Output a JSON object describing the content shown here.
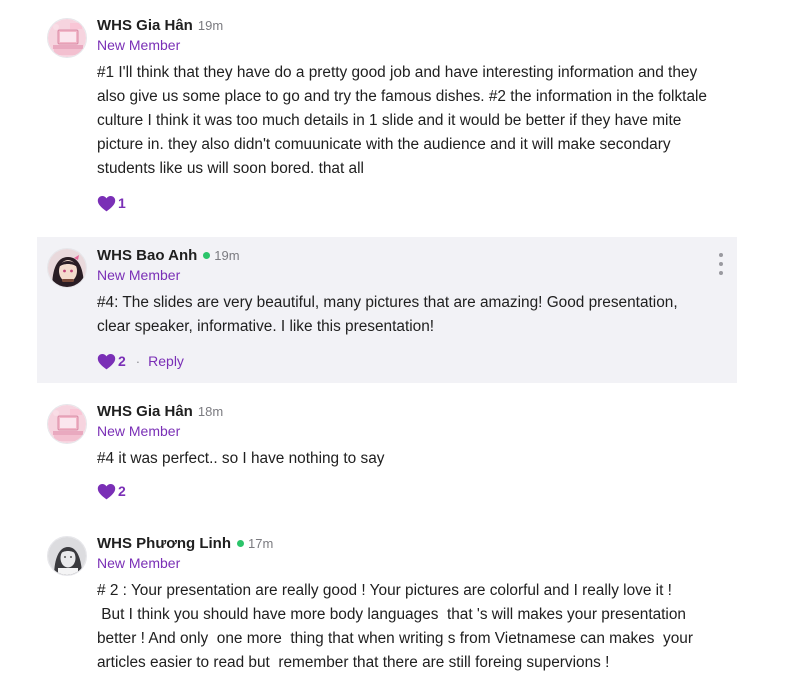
{
  "colors": {
    "accent": "#7a2fb6",
    "online": "#2bc46a",
    "highlight_bg": "#f2f2f6"
  },
  "comments": [
    {
      "author": "WHS Gia Hân",
      "time": "19m",
      "role": "New Member",
      "paragraphs": [
        "#1 I'll think that they have do a pretty good job and have interesting information and they also give us some place to go and try the famous dishes. #2 the information in the folktale culture I think it was too much details in 1 slide and it would be better if they have mite picture in. they also didn't comuunicate with the audience and it will make secondary students like us will soon bored. that all"
      ],
      "likes": "1",
      "avatar_icon": "laptop-avatar-icon"
    },
    {
      "author": "WHS Bao Anh",
      "time": "19m",
      "role": "New Member",
      "paragraphs": [
        "#4: The slides are very beautiful, many pictures that are amazing! Good presentation, clear speaker, informative. I like this presentation!"
      ],
      "likes": "2",
      "reply_label": "Reply",
      "avatar_icon": "anime-girl-avatar-icon"
    },
    {
      "author": "WHS Gia Hân",
      "time": "18m",
      "role": "New Member",
      "paragraphs": [
        "#4 it was perfect.. so I have nothing to say"
      ],
      "likes": "2",
      "avatar_icon": "laptop-avatar-icon"
    },
    {
      "author": "WHS Phương Linh",
      "time": "17m",
      "role": "New Member",
      "paragraphs": [
        "# 2 : Your presentation are really good ! Your pictures are colorful and I really love it !",
        " But I think you should have more body languages  that 's will makes your presentation better ! And only  one more  thing that when writing s from Vietnamese can makes  your articles easier to read but  remember that there are still foreing supervions !"
      ],
      "avatar_icon": "grayscale-portrait-avatar-icon"
    }
  ]
}
